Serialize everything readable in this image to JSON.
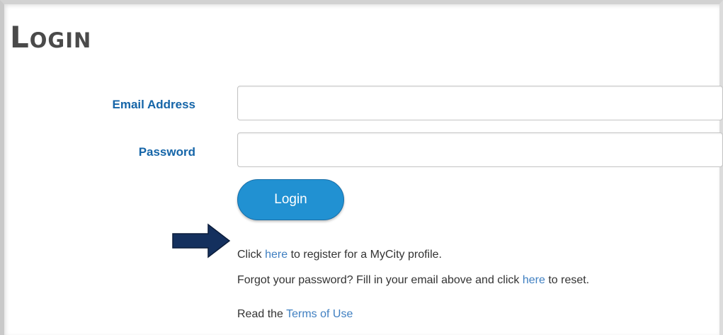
{
  "page": {
    "title": "Login"
  },
  "form": {
    "email_label": "Email Address",
    "email_value": "",
    "password_label": "Password",
    "password_value": "",
    "login_button": "Login"
  },
  "info": {
    "register": {
      "prefix": "Click ",
      "link": "here",
      "suffix": " to register for a MyCity profile."
    },
    "forgot": {
      "prefix": "Forgot your password? Fill in your email above and click ",
      "link": "here",
      "suffix": " to reset."
    },
    "terms": {
      "prefix": "Read the ",
      "link": "Terms of Use"
    }
  },
  "colors": {
    "label": "#1565a8",
    "button": "#2191d2",
    "link": "#3f7fc1",
    "arrow": "#14305e",
    "title": "#4a4a4a"
  },
  "icons": {
    "pointer": "right-arrow-icon"
  }
}
